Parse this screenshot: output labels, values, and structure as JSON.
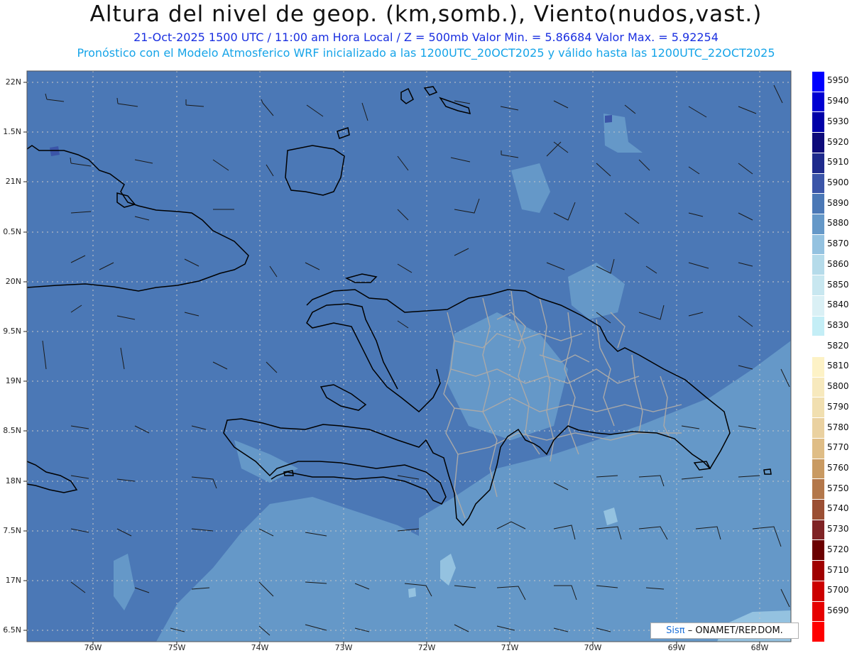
{
  "header": {
    "title": "Altura del nivel de geop. (km,somb.), Viento(nudos,vast.)",
    "subtitle_line1": "21-Oct-2025  1500 UTC / 11:00 am Hora Local / Z = 500mb    Valor Min. = 5.86684   Valor Max. = 5.92254",
    "subtitle_line2": "Pronóstico con el Modelo Atmosferico WRF inicializado a las 1200UTC_20OCT2025 y válido hasta las  1200UTC_22OCT2025"
  },
  "axes": {
    "lat_labels": [
      "22N",
      "1.5N",
      "21N",
      "0.5N",
      "20N",
      "9.5N",
      "19N",
      "8.5N",
      "18N",
      "7.5N",
      "17N",
      "6.5N"
    ],
    "lon_labels": [
      "76W",
      "75W",
      "74W",
      "73W",
      "72W",
      "71W",
      "70W",
      "69W",
      "68W"
    ]
  },
  "legend": {
    "levels": [
      {
        "value": "5950",
        "color": "#0000ff"
      },
      {
        "value": "5940",
        "color": "#0000d2"
      },
      {
        "value": "5930",
        "color": "#0000a8"
      },
      {
        "value": "5920",
        "color": "#0d0a7a"
      },
      {
        "value": "5910",
        "color": "#1e2a8c"
      },
      {
        "value": "5900",
        "color": "#3b55a8"
      },
      {
        "value": "5890",
        "color": "#4b78b6"
      },
      {
        "value": "5880",
        "color": "#6598c8"
      },
      {
        "value": "5870",
        "color": "#94c2e0"
      },
      {
        "value": "5860",
        "color": "#b5dbea"
      },
      {
        "value": "5850",
        "color": "#c8e7f0"
      },
      {
        "value": "5840",
        "color": "#daf0f5"
      },
      {
        "value": "5830",
        "color": "#c4eef6"
      },
      {
        "value": "5820",
        "color": "#ffffff"
      },
      {
        "value": "5810",
        "color": "#fdf2c6"
      },
      {
        "value": "5800",
        "color": "#f7e9bd"
      },
      {
        "value": "5790",
        "color": "#f1dfb0"
      },
      {
        "value": "5780",
        "color": "#ead1a0"
      },
      {
        "value": "5770",
        "color": "#dfbd86"
      },
      {
        "value": "5760",
        "color": "#c99a62"
      },
      {
        "value": "5750",
        "color": "#b3774a"
      },
      {
        "value": "5740",
        "color": "#9b4f33"
      },
      {
        "value": "5730",
        "color": "#7f2325"
      },
      {
        "value": "5720",
        "color": "#6b0000"
      },
      {
        "value": "5710",
        "color": "#a00000"
      },
      {
        "value": "5700",
        "color": "#cc0000"
      },
      {
        "value": "5690",
        "color": "#e60000"
      },
      {
        "value": "",
        "color": "#ff0000"
      }
    ]
  },
  "credit": {
    "brand": "Sisπ",
    "text": "– ONAMET/REP.DOM."
  },
  "colors": {
    "ocean_main": "#4b78b6",
    "ocean_south": "#6598c8",
    "patch_dark": "#3b55a8",
    "patch_light": "#94c2e0",
    "coast": "#000000",
    "provinces": "#a9a9a9"
  }
}
